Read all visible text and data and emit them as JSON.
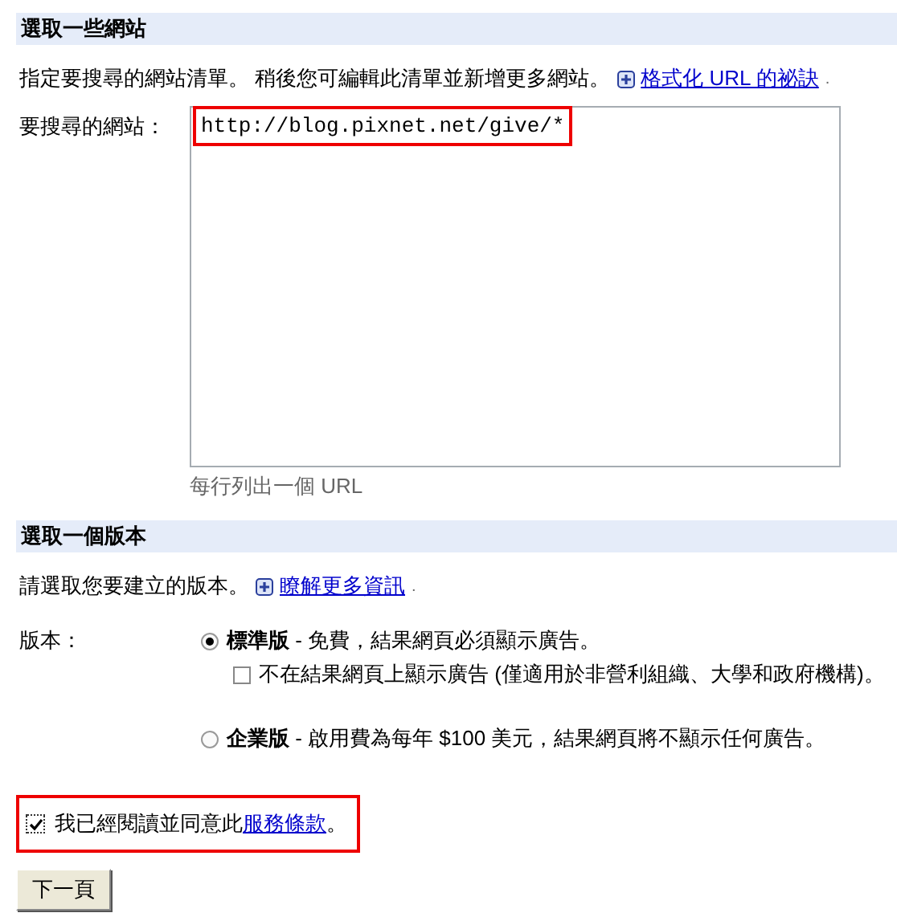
{
  "site_section": {
    "title": "選取一些網站",
    "description": "指定要搜尋的網站清單。 稍後您可編輯此清單並新增更多網站。",
    "link": "格式化 URL 的祕訣",
    "link_suffix": ".",
    "field": {
      "label": "要搜尋的網站：",
      "value": "http://blog.pixnet.net/give/*",
      "hint": "每行列出一個 URL"
    }
  },
  "edition_section": {
    "title": "選取一個版本",
    "description": "請選取您要建立的版本。",
    "link": "瞭解更多資訊",
    "link_suffix": ".",
    "label": "版本：",
    "options": [
      {
        "name": "標準版",
        "description": " - 免費，結果網頁必須顯示廣告。",
        "selected": true,
        "suboption": {
          "label": "不在結果網頁上顯示廣告 (僅適用於非營利組織、大學和政府機構)。",
          "checked": false
        }
      },
      {
        "name": "企業版",
        "description": " - 啟用費為每年 $100 美元，結果網頁將不顯示任何廣告。",
        "selected": false
      }
    ]
  },
  "terms": {
    "checked": true,
    "text": "我已經閱讀並同意此",
    "link": "服務條款",
    "suffix": "。"
  },
  "button": "下一頁"
}
